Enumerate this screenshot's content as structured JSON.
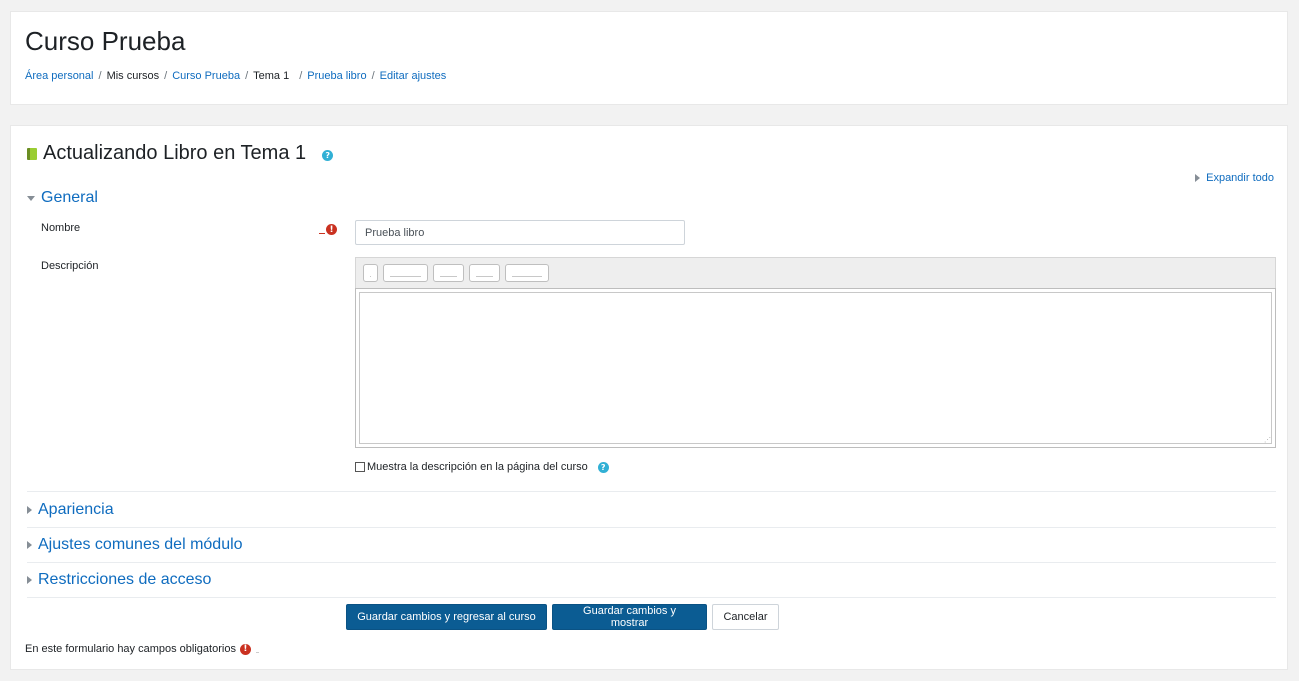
{
  "header": {
    "title": "Curso Prueba",
    "breadcrumb": {
      "area_personal": "Área personal",
      "mis_cursos": "Mis cursos",
      "curso_prueba": "Curso Prueba",
      "tema": "Tema 1",
      "prueba_libro": "Prueba libro",
      "editar_ajustes": "Editar ajustes",
      "separator": "/"
    }
  },
  "form": {
    "heading": "Actualizando Libro en Tema 1",
    "help_glyph": "?",
    "expand_all": "Expandir todo",
    "sections": {
      "general": "General",
      "apariencia": "Apariencia",
      "ajustes_comunes": "Ajustes comunes del módulo",
      "restricciones": "Restricciones de acceso"
    },
    "fields": {
      "nombre_label": "Nombre",
      "nombre_value": "Prueba libro",
      "descripcion_label": "Descripción",
      "show_description_label": "Muestra la descripción en la página del curso"
    },
    "required_glyph": "!",
    "buttons": {
      "save_return": "Guardar cambios y regresar al curso",
      "save_display": "Guardar cambios y mostrar",
      "cancel": "Cancelar"
    },
    "required_note": "En este formulario hay campos obligatorios"
  },
  "icons": {
    "module": "book-icon",
    "help": "help-icon",
    "required": "exclamation-icon"
  },
  "colors": {
    "link": "#0f6cbf",
    "primary_button": "#0b5c93",
    "required": "#ca3120",
    "help": "#31b0d5"
  }
}
